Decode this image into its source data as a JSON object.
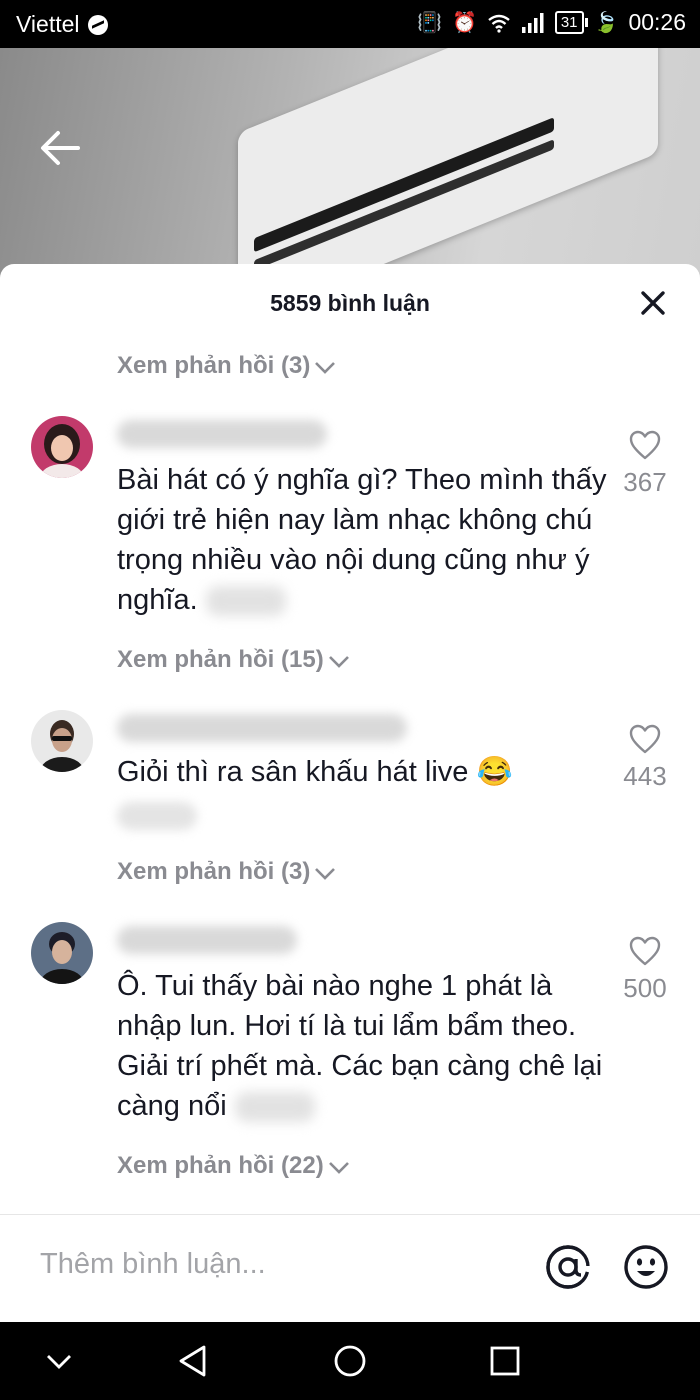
{
  "status_bar": {
    "carrier": "Viettel",
    "battery": "31",
    "time": "00:26"
  },
  "header": {
    "title": "5859 bình luận"
  },
  "comments": [
    {
      "text": "Bài hát có ý nghĩa gì? Theo mình thấy giới trẻ hiện nay làm nhạc không chú trọng nhiều vào nội dung cũng như ý nghĩa.",
      "likes": "367",
      "replies": "Xem phản hồi (15)"
    },
    {
      "text": "Giỏi thì ra sân khấu hát live 😂",
      "likes": "443",
      "replies": "Xem phản hồi (3)"
    },
    {
      "text": "Ô. Tui thấy bài nào nghe 1 phát là nhập lun. Hơi tí là tui lẩm bẩm theo. Giải trí phết mà. Các bạn càng chê lại càng nổi",
      "likes": "500",
      "replies": "Xem phản hồi (22)"
    }
  ],
  "top_replies": "Xem phản hồi (3)",
  "input": {
    "placeholder": "Thêm bình luận..."
  },
  "icons": {
    "back": "arrow-left-icon",
    "close": "close-icon",
    "like": "heart-icon",
    "mention": "at-icon",
    "emoji": "emoji-icon",
    "nav": [
      "chevron-down-icon",
      "back-triangle-icon",
      "home-circle-icon",
      "recents-square-icon"
    ]
  },
  "colors": {
    "text": "#161823",
    "secondary": "#8a8b91",
    "placeholder": "#a3a4a8"
  }
}
